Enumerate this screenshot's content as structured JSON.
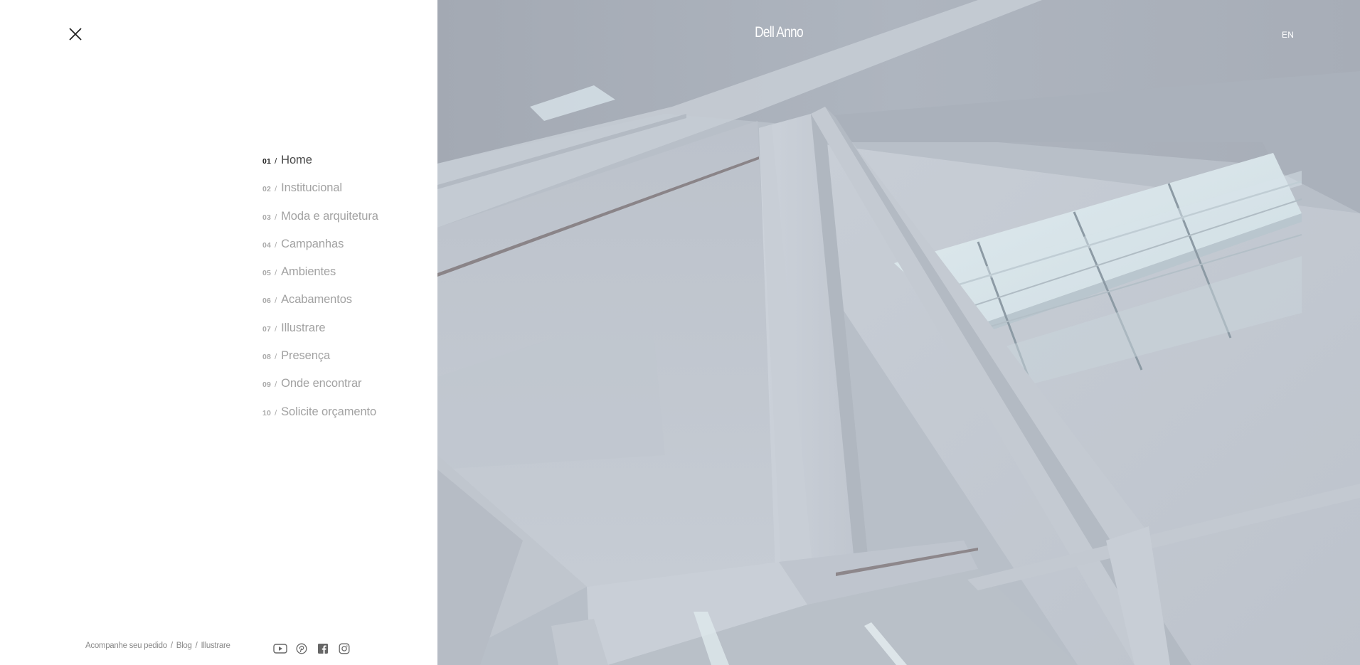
{
  "header": {
    "brand": "Dell Anno",
    "language": "EN"
  },
  "menu": {
    "items": [
      {
        "num": "01",
        "sep": "/",
        "label": "Home",
        "active": true
      },
      {
        "num": "02",
        "sep": "/",
        "label": "Institucional"
      },
      {
        "num": "03",
        "sep": "/",
        "label": "Moda e arquitetura"
      },
      {
        "num": "04",
        "sep": "/",
        "label": "Campanhas"
      },
      {
        "num": "05",
        "sep": "/",
        "label": "Ambientes"
      },
      {
        "num": "06",
        "sep": "/",
        "label": "Acabamentos"
      },
      {
        "num": "07",
        "sep": "/",
        "label": "Illustrare"
      },
      {
        "num": "08",
        "sep": "/",
        "label": "Presença"
      },
      {
        "num": "09",
        "sep": "/",
        "label": "Onde encontrar"
      },
      {
        "num": "10",
        "sep": "/",
        "label": "Solicite orçamento"
      }
    ]
  },
  "footer": {
    "links": [
      {
        "label": "Acompanhe seu pedido"
      },
      {
        "label": "Blog"
      },
      {
        "label": "Illustrare"
      }
    ],
    "separator": "/",
    "socials": [
      "youtube-icon",
      "pinterest-icon",
      "facebook-icon",
      "instagram-icon"
    ]
  },
  "colors": {
    "panel_bg": "#ffffff",
    "active_text": "#222222",
    "inactive_text": "#a2a2a2",
    "overlay_text": "#ffffff"
  }
}
